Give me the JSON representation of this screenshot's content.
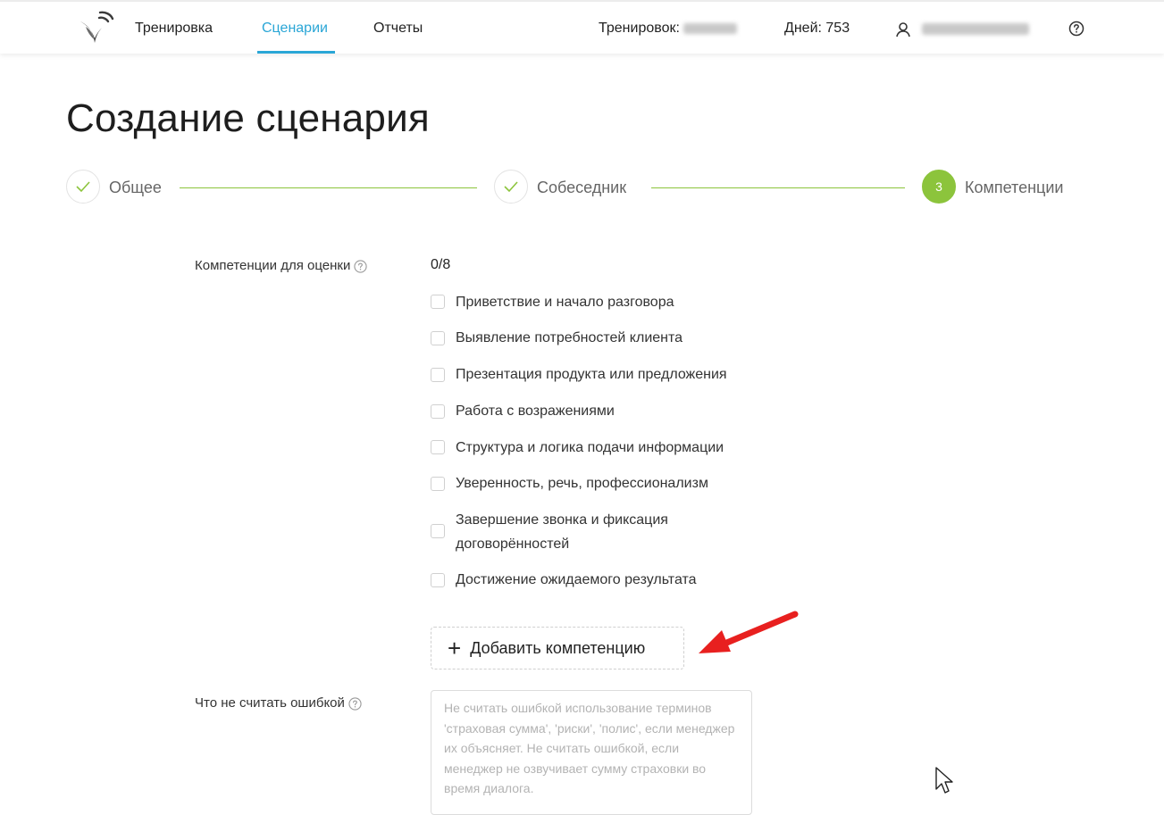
{
  "nav": {
    "items": [
      "Тренировка",
      "Сценарии",
      "Отчеты"
    ],
    "active": "Сценарии",
    "trainings_label": "Тренировок:",
    "days_label": "Дней: 753"
  },
  "page": {
    "title": "Создание сценария"
  },
  "stepper": {
    "steps": [
      {
        "label": "Общее",
        "state": "done"
      },
      {
        "label": "Собеседник",
        "state": "done"
      },
      {
        "label": "Компетенции",
        "state": "current",
        "number": "3"
      }
    ]
  },
  "competencies": {
    "label": "Компетенции для оценки",
    "counter": "0/8",
    "items": [
      "Приветствие и начало разговора",
      "Выявление потребностей клиента",
      "Презентация продукта или предложения",
      "Работа с возражениями",
      "Структура и логика подачи информации",
      "Уверенность, речь, профессионализм",
      "Завершение звонка и фиксация договорённостей",
      "Достижение ожидаемого результата"
    ],
    "add_button": "Добавить компетенцию"
  },
  "not_error": {
    "label": "Что не считать ошибкой",
    "placeholder": "Не считать ошибкой использование терминов 'страховая сумма', 'риски', 'полис', если менеджер их объясняет. Не считать ошибкой, если менеджер не озвучивает сумму страховки во время диалога."
  },
  "colors": {
    "accent": "#2aa6d6",
    "success": "#8cc43c",
    "annotation": "#e8201f"
  },
  "icons": [
    "logo-icon",
    "user-icon",
    "help-icon",
    "check-icon",
    "question-icon",
    "plus-icon",
    "arrow-icon",
    "cursor-icon"
  ]
}
